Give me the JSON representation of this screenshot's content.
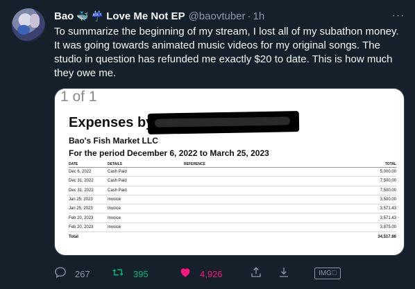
{
  "user": {
    "display_name": "Bao",
    "emoji_1": "🐳",
    "emoji_2": "☔",
    "ep_name": "Love Me Not EP",
    "handle": "@baovtuber",
    "separator": "·",
    "time": "1h"
  },
  "more_icon": "···",
  "tweet": {
    "text": "To summarize the beginning of my stream, I lost all of my subathon money. It was going towards animated music videos for my original songs. The studio in question has refunded me exactly $20 to date. This is how much they owe me."
  },
  "media": {
    "pager": "1 of 1",
    "doc_title": "Expenses by",
    "company": "Bao's Fish Market LLC",
    "period": "For the period December 6, 2022 to March 25, 2023",
    "columns": [
      "DATE",
      "DETAILS",
      "REFERENCE",
      "TOTAL"
    ],
    "rows": [
      [
        "Dec 6, 2022",
        "Cash Paid",
        "",
        "5,000.00"
      ],
      [
        "Dec 31, 2022",
        "Cash Paid",
        "",
        "7,500.00"
      ],
      [
        "Dec 31, 2022",
        "Cash Paid",
        "",
        "7,500.00"
      ],
      [
        "Jan 25, 2023",
        "Invoice",
        "",
        "3,500.00"
      ],
      [
        "Jan 25, 2023",
        "Invoice",
        "",
        "3,571.43"
      ],
      [
        "Feb 20, 2023",
        "Invoice",
        "",
        "3,571.43"
      ],
      [
        "Feb 20, 2023",
        "Invoice",
        "",
        "3,875.00"
      ]
    ],
    "total_label": "Total",
    "total_value": "34,517.86"
  },
  "actions": {
    "reply_count": "267",
    "retweet_count": "395",
    "like_count": "4,926",
    "img_badge": "IMG⃞"
  },
  "colors": {
    "background": "#15202b",
    "retweet": "#00ba7c",
    "like": "#f91880",
    "muted": "#8b98a5"
  }
}
